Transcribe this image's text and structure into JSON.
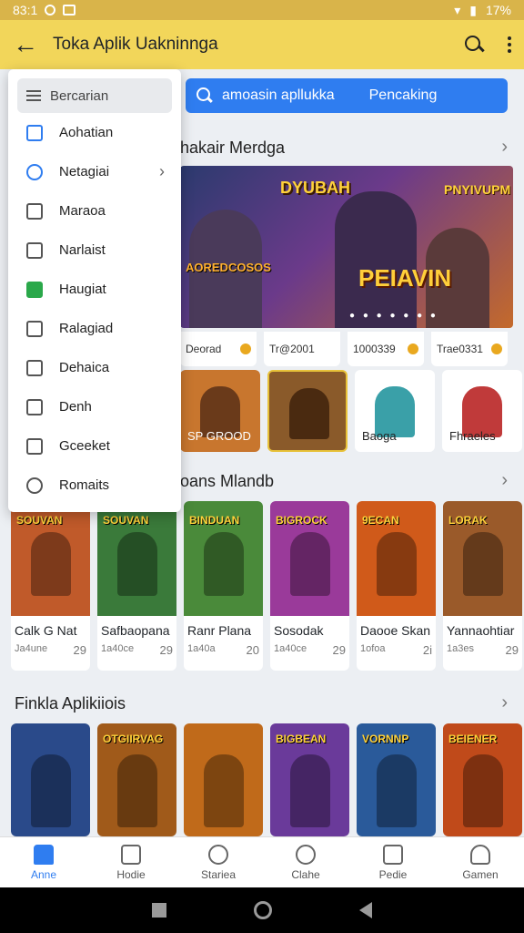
{
  "status": {
    "time": "83:1",
    "battery": "17%"
  },
  "appbar": {
    "title": "Toka Aplik Uakninnga"
  },
  "search": {
    "placeholder": "amoasin apllukka",
    "secondary": "Pencaking"
  },
  "drawer": {
    "search_label": "Bercarian",
    "items": [
      {
        "label": "Aohatian",
        "icon": "app-icon"
      },
      {
        "label": "Netagiai",
        "icon": "network-icon",
        "has_arrow": true
      },
      {
        "label": "Maraoa",
        "icon": "box-icon"
      },
      {
        "label": "Narlaist",
        "icon": "calendar-icon"
      },
      {
        "label": "Haugiat",
        "icon": "green-tag-icon"
      },
      {
        "label": "Ralagiad",
        "icon": "lock-icon"
      },
      {
        "label": "Dehaica",
        "icon": "folder-icon"
      },
      {
        "label": "Denh",
        "icon": "bookmark-icon"
      },
      {
        "label": "Gceeket",
        "icon": "camera-icon"
      },
      {
        "label": "Romaits",
        "icon": "link-icon"
      }
    ]
  },
  "section1": {
    "title": "hakair Merdga",
    "hero": {
      "title_left": "DYUBAH",
      "title_right": "PNYIVUPM",
      "subtitle": "AOREDCOSOS",
      "center": "PEIAVIN"
    },
    "mini": [
      "Deorad",
      "Tr@2001",
      "1000339",
      "Trae0331"
    ],
    "tiles": [
      {
        "label": "SP GROOD",
        "color": "#d07a2a"
      },
      {
        "label": "",
        "color": "#7a4a1a"
      },
      {
        "label": "Baoga",
        "color": "#ffffff"
      },
      {
        "label": "Fhraeles",
        "color": "#ffffff"
      }
    ]
  },
  "section2": {
    "title": "oans Mlandb",
    "cards": [
      {
        "name": "Calk G Nat",
        "meta": "Ja4une",
        "rating": "29",
        "cap": "SOUVAN",
        "color": "#c05a2a"
      },
      {
        "name": "Safbaopana",
        "meta": "1a40ce",
        "rating": "29",
        "cap": "SOUVAN",
        "color": "#3a7a3a"
      },
      {
        "name": "Ranr Plana",
        "meta": "1a40a",
        "rating": "20",
        "cap": "BINDUAN",
        "color": "#4a8a3a"
      },
      {
        "name": "Sosodak",
        "meta": "1a40ce",
        "rating": "29",
        "cap": "BIGROCK",
        "color": "#9a3a9a"
      },
      {
        "name": "Daooe Skan",
        "meta": "1ofoa",
        "rating": "2i",
        "cap": "9ECAN",
        "color": "#d05a1a"
      },
      {
        "name": "Yannaohtiar",
        "meta": "1a3es",
        "rating": "29",
        "cap": "LORAK",
        "color": "#9a5a2a"
      }
    ]
  },
  "section3": {
    "title": "Finkla Aplikiiois",
    "cards": [
      {
        "cap": "",
        "color": "#2a4a8a"
      },
      {
        "cap": "OTGIIRVAG",
        "color": "#a05a1a"
      },
      {
        "cap": "",
        "color": "#c06a1a"
      },
      {
        "cap": "BIGBEAN",
        "color": "#6a3a9a"
      },
      {
        "cap": "VORNNP",
        "color": "#2a5a9a"
      },
      {
        "cap": "BEIENER",
        "color": "#c04a1a"
      }
    ]
  },
  "nav": [
    {
      "label": "Anne",
      "active": true
    },
    {
      "label": "Hodie"
    },
    {
      "label": "Stariea"
    },
    {
      "label": "Clahe"
    },
    {
      "label": "Pedie"
    },
    {
      "label": "Gamen"
    }
  ]
}
